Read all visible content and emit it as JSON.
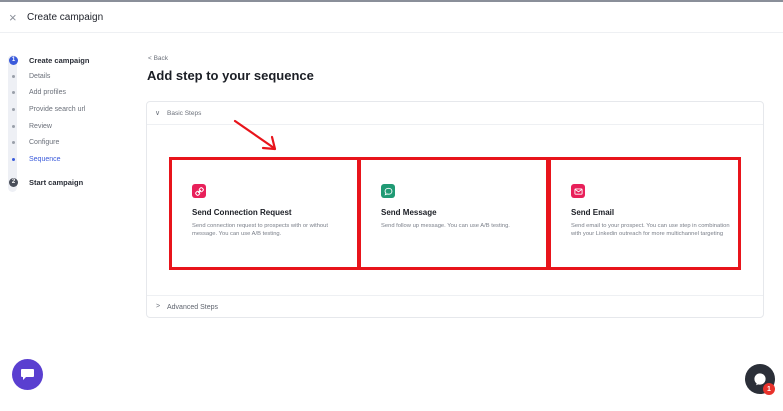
{
  "header": {
    "close_glyph": "×",
    "title": "Create campaign"
  },
  "stepper": {
    "main_steps": [
      {
        "number": "1",
        "label": "Create campaign",
        "color": "#3b5bdb"
      },
      {
        "number": "2",
        "label": "Start campaign",
        "color": "#4a4f5a"
      }
    ],
    "sub_steps": [
      {
        "label": "Details",
        "active": false
      },
      {
        "label": "Add profiles",
        "active": false
      },
      {
        "label": "Provide search url",
        "active": false
      },
      {
        "label": "Review",
        "active": false
      },
      {
        "label": "Configure",
        "active": false
      },
      {
        "label": "Sequence",
        "active": true
      }
    ]
  },
  "main": {
    "back_label": "< Back",
    "page_title": "Add step to your sequence",
    "basic_section": {
      "chevron": "∨",
      "label": "Basic Steps"
    },
    "advanced_section": {
      "chevron": ">",
      "label": "Advanced Steps"
    },
    "options": [
      {
        "title": "Send Connection Request",
        "description": "Send connection request to prospects with or without message. You can use A/B testing.",
        "icon": "link-icon",
        "icon_color": "#e8205a"
      },
      {
        "title": "Send Message",
        "description": "Send follow up message. You can use A/B testing.",
        "icon": "chat-bubble-icon",
        "icon_color": "#1f9a74"
      },
      {
        "title": "Send Email",
        "description": "Send email to your prospect. You can use step in combination with your Linkedin outreach for more multichannel targeting",
        "icon": "mail-icon",
        "icon_color": "#e8205a"
      }
    ]
  },
  "widgets": {
    "help_badge_count": "1"
  },
  "colors": {
    "accent": "#3b5bdb",
    "highlight_border": "#e8141b",
    "chat_button": "#5a3fd0",
    "help_button": "#2b2f38"
  }
}
